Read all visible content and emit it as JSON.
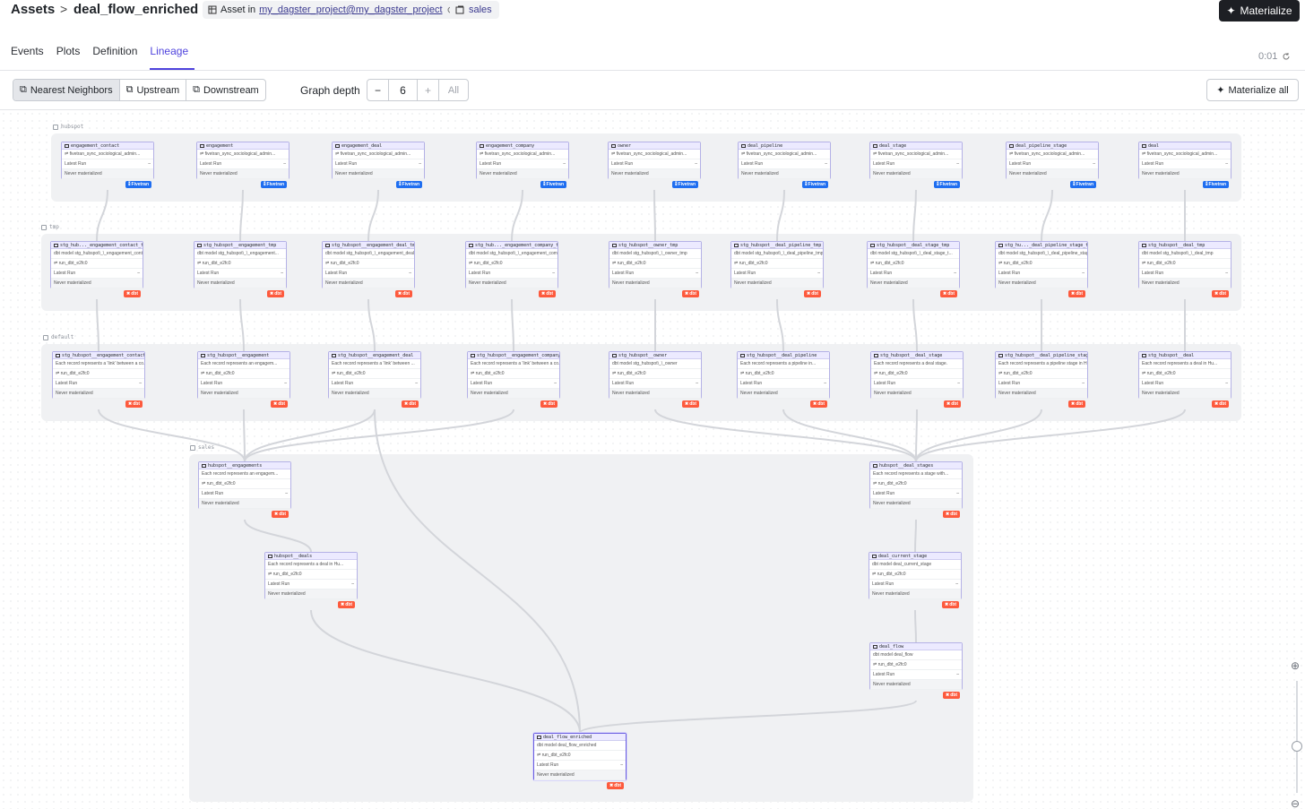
{
  "header": {
    "breadcrumb_root": "Assets",
    "breadcrumb_sep": ">",
    "breadcrumb_leaf": "deal_flow_enriched",
    "asset_in_label": "Asset in",
    "asset_location": "my_dagster_project@my_dagster_project",
    "group_name": "sales",
    "materialize_label": "Materialize"
  },
  "tabs": [
    "Events",
    "Plots",
    "Definition",
    "Lineage"
  ],
  "active_tab": "Lineage",
  "timer": "0:01",
  "toolbar": {
    "nearest": "Nearest Neighbors",
    "upstream": "Upstream",
    "downstream": "Downstream",
    "graph_depth_label": "Graph depth",
    "minus": "−",
    "depth_value": "6",
    "plus": "+",
    "all": "All",
    "materialize_all": "Materialize all"
  },
  "groups": {
    "hubspot": "hubspot",
    "tmp": "tmp",
    "default": "default",
    "sales": "sales"
  },
  "node_rows": {
    "latest_run": "Latest Run",
    "dash": "–",
    "never": "Never materialized",
    "code": "run_dbt_e2fc0",
    "fivetran_op": "fivetran_sync_sociological_admin...",
    "badge_dbt": "dbt",
    "badge_fivetran": "Fivetran"
  },
  "colors": {
    "accent": "#4f43dd",
    "dbt": "#fd5a3d",
    "fivetran": "#1f6ef0"
  },
  "hubspot_nodes": [
    "engagement_contact",
    "engagement",
    "engagement_deal",
    "engagement_company",
    "owner",
    "deal_pipeline",
    "deal_stage",
    "deal_pipeline_stage",
    "deal"
  ],
  "tmp_nodes": [
    {
      "name": "stg_hub..._engagement_contact_tmp",
      "desc": "dbt model stg_hubspot\\_\\_engagement_conta..."
    },
    {
      "name": "stg_hubspot__engagement_tmp",
      "desc": "dbt model stg_hubspot\\_\\_engagement..."
    },
    {
      "name": "stg_hubspot__engagement_deal_tmp",
      "desc": "dbt model stg_hubspot\\_\\_engagement_deal_t..."
    },
    {
      "name": "stg_hub..._engagement_company_tmp",
      "desc": "dbt model stg_hubspot\\_\\_engagement_comp..."
    },
    {
      "name": "stg_hubspot__owner_tmp",
      "desc": "dbt model stg_hubspot\\_\\_owner_tmp"
    },
    {
      "name": "stg_hubspot__deal_pipeline_tmp",
      "desc": "dbt model stg_hubspot\\_\\_deal_pipeline_tmp"
    },
    {
      "name": "stg_hubspot__deal_stage_tmp",
      "desc": "dbt model stg_hubspot\\_\\_deal_stage_t..."
    },
    {
      "name": "stg_hu..._deal_pipeline_stage_tmp",
      "desc": "dbt model stg_hubspot\\_\\_deal_pipeline_stage..."
    },
    {
      "name": "stg_hubspot__deal_tmp",
      "desc": "dbt model stg_hubspot\\_\\_deal_tmp"
    }
  ],
  "default_nodes": [
    {
      "name": "stg_hubspot__engagement_contact",
      "desc": "Each record represents a 'link' between a co..."
    },
    {
      "name": "stg_hubspot__engagement",
      "desc": "Each record represents an engagem..."
    },
    {
      "name": "stg_hubspot__engagement_deal",
      "desc": "Each record represents a 'link' between ..."
    },
    {
      "name": "stg_hubspot__engagement_company",
      "desc": "Each record represents a 'link' between a co..."
    },
    {
      "name": "stg_hubspot__owner",
      "desc": "dbt model stg_hubspot\\_\\_owner"
    },
    {
      "name": "stg_hubspot__deal_pipeline",
      "desc": "Each record represents a pipeline in..."
    },
    {
      "name": "stg_hubspot__deal_stage",
      "desc": "Each record represents a deal stage."
    },
    {
      "name": "stg_hubspot__deal_pipeline_stage",
      "desc": "Each record represents a pipeline stage in Hu..."
    },
    {
      "name": "stg_hubspot__deal",
      "desc": "Each record represents a deal in Hu..."
    }
  ],
  "sales_nodes": [
    {
      "name": "hubspot__engagements",
      "desc": "Each record represents an engagem..."
    },
    {
      "name": "hubspot__deal_stages",
      "desc": "Each record represents a stage with..."
    },
    {
      "name": "hubspot__deals",
      "desc": "Each record represents a deal in Hu..."
    },
    {
      "name": "deal_current_stage",
      "desc": "dbt model deal_current_stage"
    },
    {
      "name": "deal_flow",
      "desc": "dbt model deal_flow"
    },
    {
      "name": "deal_flow_enriched",
      "desc": "dbt model deal_flow_enriched"
    }
  ]
}
